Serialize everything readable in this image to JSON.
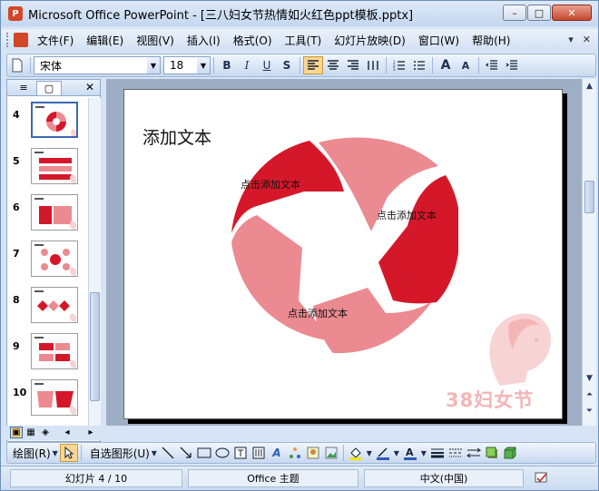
{
  "window": {
    "title": "Microsoft Office PowerPoint - [三八妇女节热情如火红色ppt模板.pptx]",
    "app_icon": "P",
    "min_glyph": "–",
    "max_glyph": "□",
    "close_glyph": "✕"
  },
  "menu": {
    "items": [
      "文件(F)",
      "编辑(E)",
      "视图(V)",
      "插入(I)",
      "格式(O)",
      "工具(T)",
      "幻灯片放映(D)",
      "窗口(W)",
      "帮助(H)"
    ],
    "right_glyphs": [
      "▾",
      "✕"
    ]
  },
  "toolbar": {
    "font_name": "宋体",
    "font_size": "18",
    "bold": "B",
    "italic": "I",
    "underline": "U",
    "shadow": "S",
    "grow_font": "A",
    "shrink_font": "A"
  },
  "slide_pane": {
    "tab_outline": "≡",
    "tab_slides": "▢",
    "close": "✕",
    "numbers": [
      "4",
      "5",
      "6",
      "7",
      "8",
      "9",
      "10"
    ],
    "selected_index": 0
  },
  "slide": {
    "title": "添加文本",
    "labels": [
      "点击添加文本",
      "点击添加文本",
      "点击添加文本"
    ],
    "logo_text": "38妇女节",
    "colors": {
      "dark_red": "#d4182a",
      "light_red": "#eb8a90",
      "logo": "#f3b5b5"
    }
  },
  "drawbar": {
    "draw_label": "绘图(R)",
    "autoshape_label": "自选图形(U)"
  },
  "status": {
    "slide_info": "幻灯片 4 / 10",
    "theme": "Office 主题",
    "language": "中文(中国)"
  }
}
